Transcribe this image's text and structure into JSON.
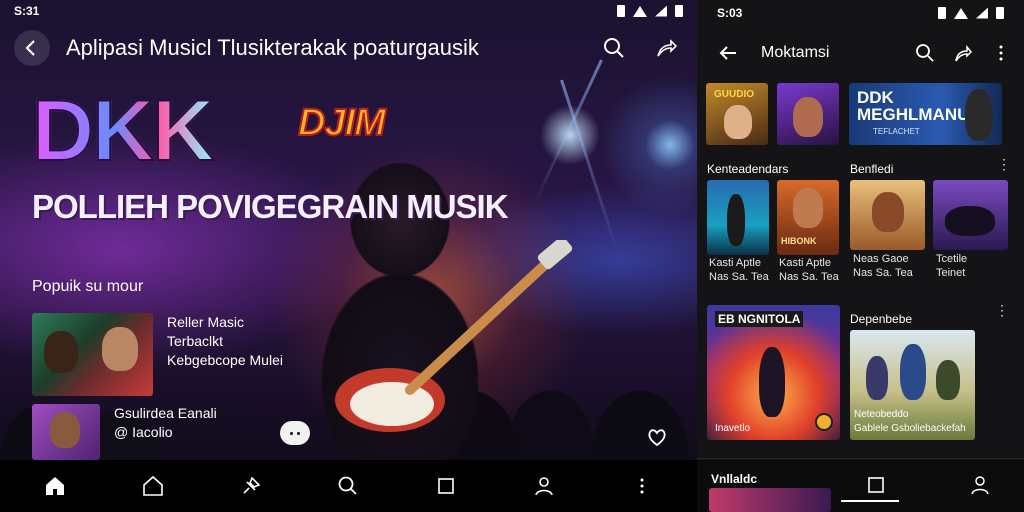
{
  "left": {
    "status": {
      "time": "S:31"
    },
    "header": {
      "title": "Aplipasi Musicl Tlusikterakak poaturgausik"
    },
    "hero": {
      "logo": "DKK",
      "badge": "DJIM",
      "subtitle": "POLLIEH POVIGEGRAIN MUSIK"
    },
    "section_label": "Popuik su mour",
    "cards": [
      {
        "lines": [
          "Reller Masic",
          "Terbaclkt",
          "Kebgebcope Mulei"
        ]
      },
      {
        "lines": [
          "Gsulirdea Eanali",
          "@ Iacolio"
        ]
      }
    ],
    "icons": {
      "back": "back-arrow-icon",
      "search": "search-icon",
      "share": "share-icon",
      "home_filled": "home-filled-icon",
      "home": "home-icon",
      "pin": "pin-icon",
      "search_nav": "search-icon",
      "stop": "square-icon",
      "profile": "profile-icon",
      "more": "more-icon",
      "heart": "heart-icon"
    }
  },
  "right": {
    "status": {
      "time": "S:03"
    },
    "header": {
      "title": "Moktamsi"
    },
    "top_tiles": [
      {
        "label": "GUUDIO"
      },
      {
        "label": ""
      },
      {
        "label": "DDK MEGHLMANU",
        "sub": "TEFLACHET"
      }
    ],
    "section1": {
      "label": "Kenteadendars",
      "right_label": "Benfledi"
    },
    "grid_caps": [
      [
        "Kasti Aptle",
        "Nas Sa. Tea"
      ],
      [
        "Kasti Aptle",
        "Nas Sa. Tea"
      ],
      [
        "Neas Gaoe",
        "Nas Sa. Tea"
      ],
      [
        "Tcetile",
        "Teinet"
      ]
    ],
    "tile_overlays": [
      "",
      "HIBONK",
      "",
      ""
    ],
    "featured": {
      "title": "EB NGNITOLA",
      "caption": "Inavetlo"
    },
    "section2": {
      "label": "Depenbebe",
      "caption": [
        "Neteobeddo",
        "Gablele Gsboliebackefah"
      ]
    },
    "bottom_section": {
      "label": "Vnllaldc"
    }
  }
}
